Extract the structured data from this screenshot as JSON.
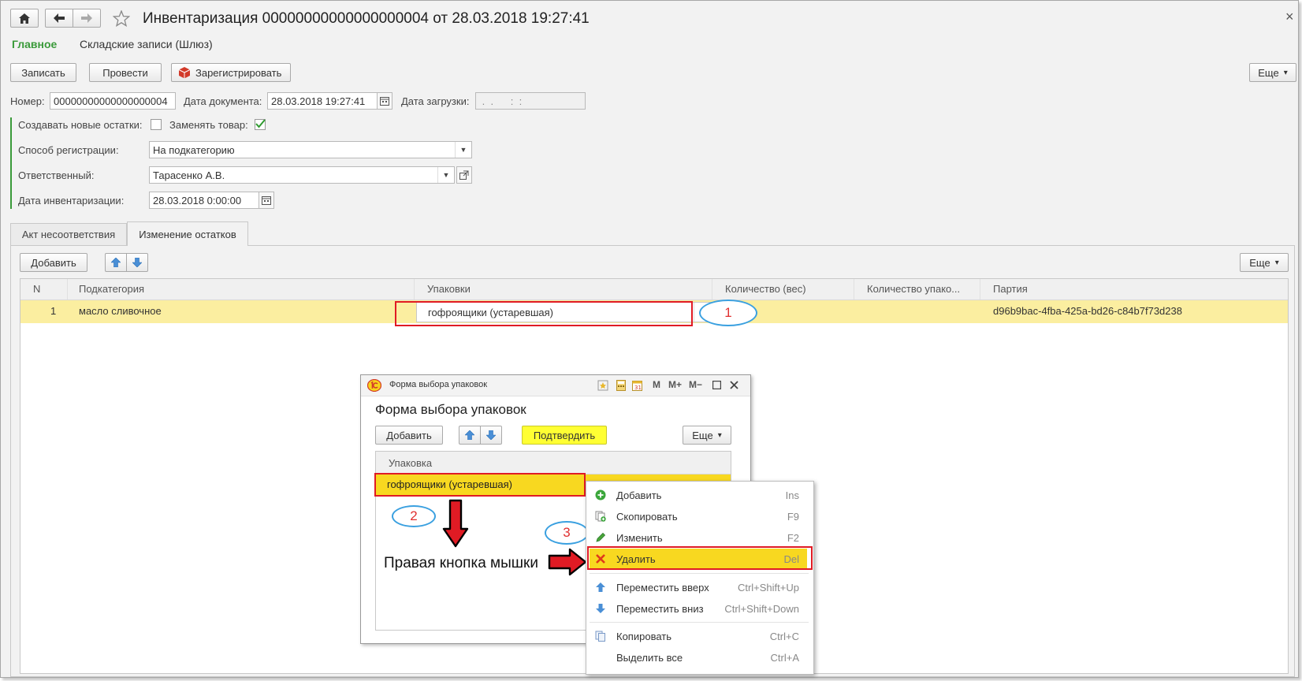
{
  "window": {
    "title": "Инвентаризация 00000000000000000004 от 28.03.2018 19:27:41",
    "close": "×"
  },
  "nav": {
    "home_icon": "home-icon",
    "back_icon": "arrow-left-icon",
    "forward_icon": "arrow-right-icon",
    "star_icon": "star-icon"
  },
  "section_tabs": [
    {
      "label": "Главное",
      "active": true
    },
    {
      "label": "Складские записи (Шлюз)",
      "active": false
    }
  ],
  "toolbar": {
    "write": "Записать",
    "post": "Провести",
    "register": "Зарегистрировать",
    "more": "Еще",
    "more_arrow": "▾"
  },
  "header_fields": {
    "number_label": "Номер:",
    "number_value": "00000000000000000004",
    "doc_date_label": "Дата документа:",
    "doc_date_value": "28.03.2018 19:27:41",
    "load_date_label": "Дата загрузки:",
    "load_date_value": " .  .      :  :  "
  },
  "options": {
    "create_new_label": "Создавать новые остатки:",
    "create_new_checked": false,
    "replace_label": "Заменять товар:",
    "replace_checked": true,
    "reg_method_label": "Способ регистрации:",
    "reg_method_value": "На подкатегорию",
    "responsible_label": "Ответственный:",
    "responsible_value": "Тарасенко А.В.",
    "inv_date_label": "Дата инвентаризации:",
    "inv_date_value": "28.03.2018  0:00:00"
  },
  "tabs": [
    {
      "label": "Акт несоответствия",
      "active": false
    },
    {
      "label": "Изменение остатков",
      "active": true
    }
  ],
  "table_toolbar": {
    "add": "Добавить",
    "more": "Еще"
  },
  "table": {
    "columns": [
      "N",
      "Подкатегория",
      "Упаковки",
      "Количество (вес)",
      "Количество упако...",
      "Партия"
    ],
    "rows": [
      {
        "n": "1",
        "subcategory": "масло сливочное",
        "packaging": "гофроящики (устаревшая)",
        "qty_weight": "",
        "qty_pack": "",
        "batch": "d96b9bac-4fba-425a-bd26-c84b7f73d238"
      }
    ],
    "ellipsis": "..."
  },
  "dialog": {
    "window_title": "Форма выбора упаковок",
    "title": "Форма выбора упаковок",
    "buttons": [
      "M",
      "M+",
      "M−"
    ],
    "add": "Добавить",
    "confirm": "Подтвердить",
    "more": "Еще",
    "column": "Упаковка",
    "row": "гофроящики (устаревшая)",
    "accent": "#ffff33"
  },
  "context_menu": [
    {
      "label": "Добавить",
      "key": "Ins",
      "icon": "plus-circle-icon"
    },
    {
      "label": "Скопировать",
      "key": "F9",
      "icon": "copy-plus-icon"
    },
    {
      "label": "Изменить",
      "key": "F2",
      "icon": "pencil-icon"
    },
    {
      "label": "Удалить",
      "key": "Del",
      "icon": "delete-x-icon",
      "highlighted": true
    },
    {
      "label": "Переместить вверх",
      "key": "Ctrl+Shift+Up",
      "icon": "arrow-up-icon"
    },
    {
      "label": "Переместить вниз",
      "key": "Ctrl+Shift+Down",
      "icon": "arrow-down-icon"
    },
    {
      "label": "Копировать",
      "key": "Ctrl+C",
      "icon": "copy-icon"
    },
    {
      "label": "Выделить все",
      "key": "Ctrl+A",
      "icon": ""
    }
  ],
  "annotations": {
    "n1": "1",
    "n2": "2",
    "n3": "3",
    "right_click": "Правая кнопка мышки",
    "marker_color": "#e01b24",
    "ellipse_color": "#3aa0e0"
  },
  "colors": {
    "accent_green": "#3a9a3a",
    "row_yellow": "#fbeea0",
    "selected_yellow": "#f8d820"
  }
}
